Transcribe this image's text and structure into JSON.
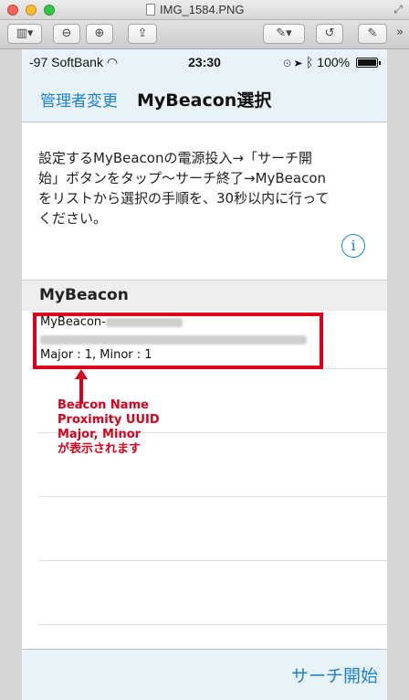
{
  "window": {
    "title": "IMG_1584.PNG",
    "toolbar": {
      "sidebar_label": "▥▾",
      "zoom_out_label": "⊖",
      "zoom_in_label": "⊕",
      "share_label": "⇪",
      "annotate_label": "✎▾",
      "rotate_label": "↺",
      "edit_label": "✎",
      "more_label": "»"
    }
  },
  "status_bar": {
    "carrier": "-97 SoftBank",
    "time": "23:30",
    "battery": "100%",
    "battery_level": 1.0
  },
  "nav": {
    "back_label": "管理者変更",
    "title": "MyBeacon選択"
  },
  "instructions": {
    "line1": "設定するMyBeaconの電源投入→「サーチ開",
    "line2": "始」ボタンをタップ〜サーチ終了→MyBeacon",
    "line3": "をリストから選択の手順を、30秒以内に行って",
    "line4": "ください。"
  },
  "section": {
    "header": "MyBeacon"
  },
  "beacon_row": {
    "name_prefix": "MyBeacon-",
    "major_minor": "Major : 1, Minor : 1"
  },
  "annotation": {
    "lines": [
      "Beacon Name",
      "Proximity UUID",
      "Major, Minor",
      "が表示されます"
    ],
    "color": "#d9001b"
  },
  "footer": {
    "search_label": "サーチ開始"
  },
  "colors": {
    "accent": "#1a82d2",
    "bar_background": "#e9f3f7",
    "highlight": "#d9001b"
  }
}
